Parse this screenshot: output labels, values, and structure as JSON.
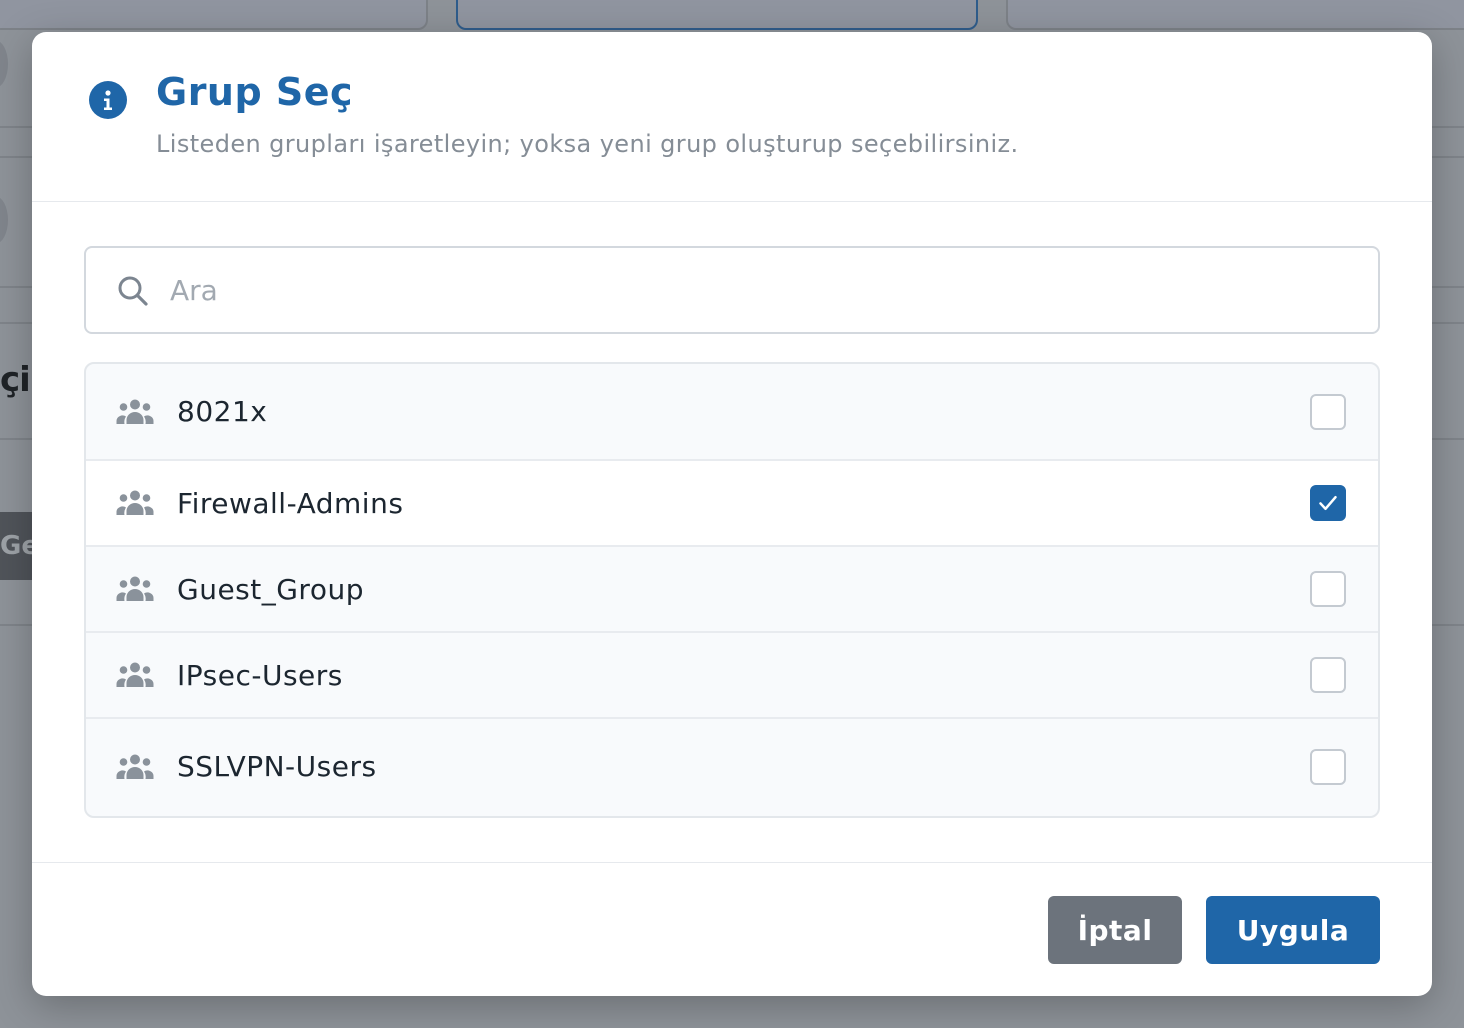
{
  "background": {
    "partial_heading": "çil",
    "partial_button": "Ge"
  },
  "modal": {
    "icon": "info-icon",
    "title": "Grup Seç",
    "subtitle": "Listeden grupları işaretleyin; yoksa yeni grup oluşturup seçebilirsiniz.",
    "search": {
      "placeholder": "Ara",
      "value": "",
      "icon": "search-icon"
    },
    "groups": [
      {
        "name": "8021x",
        "icon": "users-icon",
        "checked": false
      },
      {
        "name": "Firewall-Admins",
        "icon": "users-icon",
        "checked": true
      },
      {
        "name": "Guest_Group",
        "icon": "users-icon",
        "checked": false
      },
      {
        "name": "IPsec-Users",
        "icon": "users-icon",
        "checked": false
      },
      {
        "name": "SSLVPN-Users",
        "icon": "users-icon",
        "checked": false
      }
    ],
    "buttons": {
      "cancel": "İptal",
      "apply": "Uygula"
    }
  },
  "colors": {
    "primary": "#1f66a8",
    "secondary_button": "#6c737c",
    "overlay": "#8e9399"
  }
}
